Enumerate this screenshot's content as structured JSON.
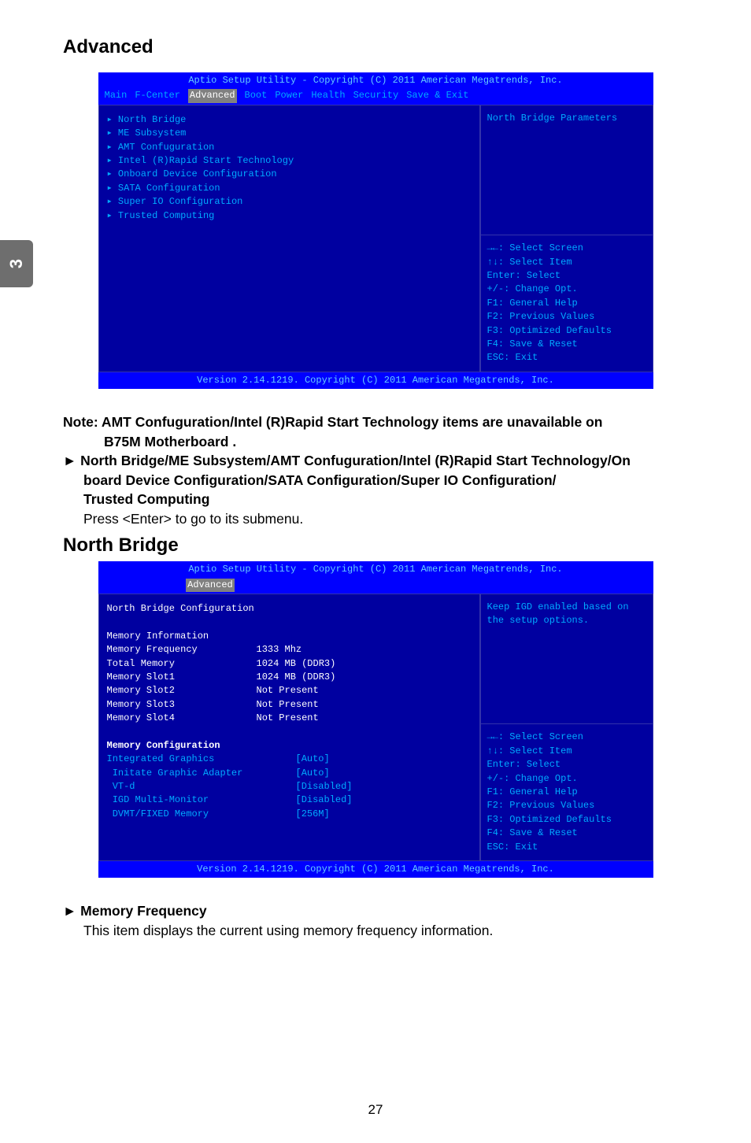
{
  "sidebar": {
    "label": "3"
  },
  "section1_title": "Advanced",
  "bios1": {
    "title": "Aptio Setup Utility - Copyright (C) 2011 American Megatrends, Inc.",
    "tabs": [
      "Main",
      "F-Center",
      "Advanced",
      "Boot",
      "Power",
      "Health",
      "Security",
      "Save & Exit"
    ],
    "active_tab_index": 2,
    "left_items": [
      "▸ North Bridge",
      "▸ ME Subsystem",
      "▸ AMT Confuguration",
      "▸ Intel (R)Rapid Start Technology",
      "▸ Onboard Device Configuration",
      "▸ SATA Configuration",
      "▸ Super IO Configuration",
      "▸ Trusted Computing"
    ],
    "right_top": "North Bridge Parameters",
    "right_bottom": [
      "→←: Select Screen",
      "↑↓: Select Item",
      "Enter: Select",
      "+/-: Change Opt.",
      "F1: General Help",
      "F2: Previous Values",
      "F3: Optimized Defaults",
      "F4: Save & Reset",
      "ESC: Exit"
    ],
    "footer": "Version 2.14.1219. Copyright (C) 2011 American Megatrends, Inc."
  },
  "notes": {
    "line1a": "Note: AMT Confuguration/Intel (R)Rapid Start Technology items are unavailable on",
    "line1b": "B75M Motherboard .",
    "line2a": "► North Bridge/ME Subsystem/AMT Confuguration/Intel (R)Rapid Start Technology/On",
    "line2b": "board Device Configuration/SATA Configuration/Super IO Configuration/",
    "line2c": "Trusted Computing",
    "line3": "Press <Enter> to go to its submenu."
  },
  "section2_title": "North Bridge",
  "bios2": {
    "title": "Aptio Setup Utility - Copyright (C) 2011 American Megatrends, Inc.",
    "active_tab": "Advanced",
    "header": "North Bridge Configuration",
    "mem_info_header": "Memory Information",
    "mem_rows": [
      {
        "label": "Memory Frequency",
        "value": "1333 Mhz"
      },
      {
        "label": "Total Memory",
        "value": "1024 MB (DDR3)"
      },
      {
        "label": "Memory Slot1",
        "value": "1024 MB (DDR3)"
      },
      {
        "label": "Memory Slot2",
        "value": "Not Present"
      },
      {
        "label": "Memory Slot3",
        "value": "Not Present"
      },
      {
        "label": "Memory Slot4",
        "value": "Not Present"
      }
    ],
    "mem_config_header": "Memory Configuration",
    "config_rows": [
      {
        "label": "Integrated Graphics",
        "value": "[Auto]"
      },
      {
        "label": " Initate Graphic Adapter",
        "value": "[Auto]"
      },
      {
        "label": " VT-d",
        "value": "[Disabled]"
      },
      {
        "label": " IGD Multi-Monitor",
        "value": "[Disabled]"
      },
      {
        "label": " DVMT/FIXED Memory",
        "value": "[256M]"
      }
    ],
    "right_top": "Keep IGD enabled based on the setup options.",
    "right_bottom": [
      "→←: Select Screen",
      "↑↓: Select Item",
      "Enter: Select",
      "+/-: Change Opt.",
      "F1: General Help",
      "F2: Previous Values",
      "F3: Optimized Defaults",
      "F4: Save & Reset",
      "ESC: Exit"
    ],
    "footer": "Version 2.14.1219. Copyright (C) 2011 American Megatrends, Inc."
  },
  "memfreq": {
    "heading": "► Memory Frequency",
    "body": "This item displays the current using memory frequency information."
  },
  "page_number": "27"
}
